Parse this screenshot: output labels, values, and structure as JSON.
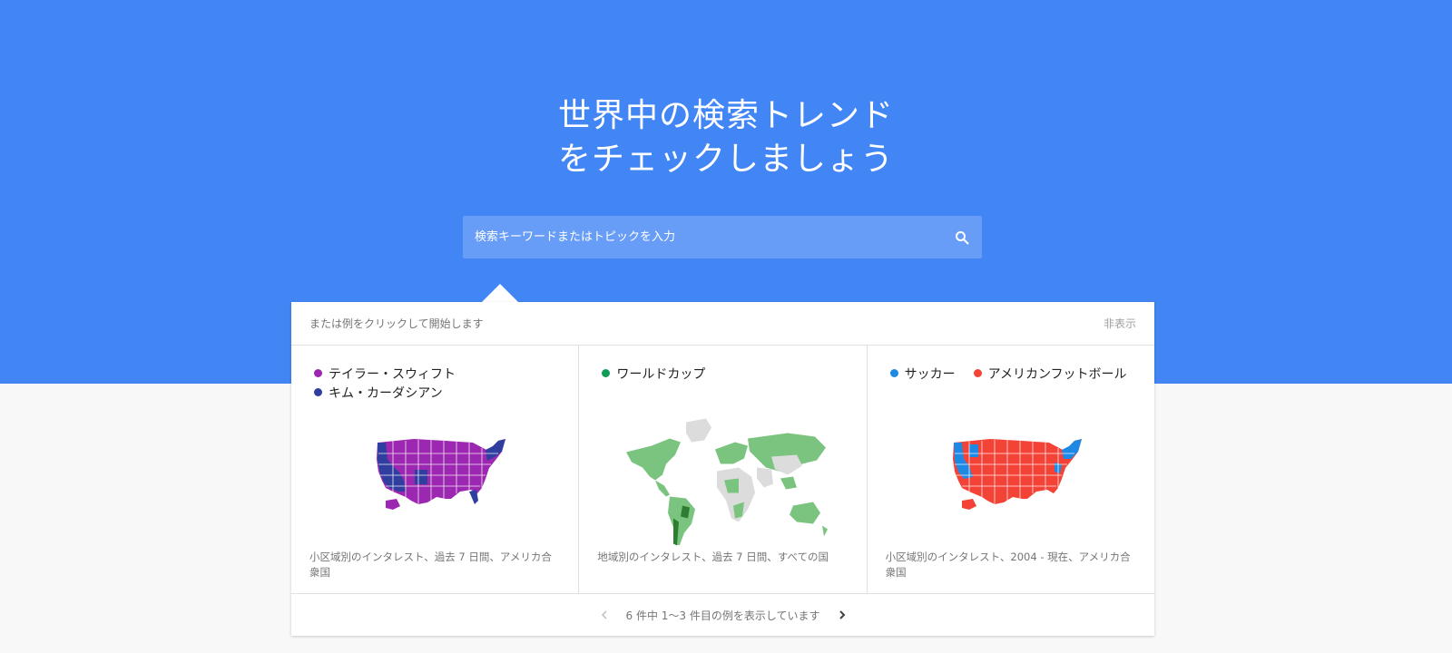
{
  "hero": {
    "line1": "世界中の検索トレンド",
    "line2": "をチェックしましょう"
  },
  "search": {
    "placeholder": "検索キーワードまたはトピックを入力",
    "icon": "search-icon"
  },
  "panel": {
    "prompt": "または例をクリックして開始します",
    "hide_label": "非表示"
  },
  "cards": [
    {
      "legend": [
        {
          "label": "テイラー・スウィフト",
          "color": "#9c27b0"
        },
        {
          "label": "キム・カーダシアン",
          "color": "#303f9f"
        }
      ],
      "map": "us-map",
      "caption": "小区域別のインタレスト、過去 7 日間、アメリカ合衆国"
    },
    {
      "legend": [
        {
          "label": "ワールドカップ",
          "color": "#0f9d58"
        }
      ],
      "map": "world-map",
      "caption": "地域別のインタレスト、過去 7 日間、すべての国"
    },
    {
      "legend": [
        {
          "label": "サッカー",
          "color": "#1e88e5"
        },
        {
          "label": "アメリカンフットボール",
          "color": "#f44336"
        }
      ],
      "map": "us-map",
      "caption": "小区域別のインタレスト、2004 - 現在、アメリカ合衆国"
    }
  ],
  "pager": {
    "label": "6 件中 1～3 件目の例を表示しています",
    "prev_icon": "chevron-left-icon",
    "next_icon": "chevron-right-icon"
  },
  "colors": {
    "hero_bg": "#4285f4",
    "page_bg": "#f8f8f8"
  }
}
